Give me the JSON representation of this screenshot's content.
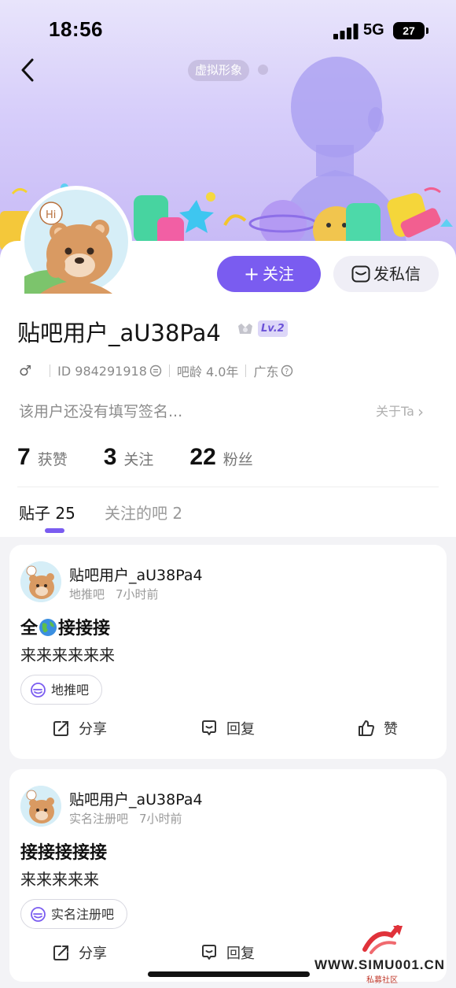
{
  "status_bar": {
    "time": "18:56",
    "network": "5G",
    "battery": "27"
  },
  "header": {
    "virtual_avatar_label": "虚拟形象"
  },
  "profile": {
    "follow_label": "关注",
    "message_label": "发私信",
    "username": "贴吧用户_aU38Pa4",
    "level": "Lv.2",
    "gender_symbol": "♂",
    "id_text": "ID 984291918",
    "bar_age": "吧龄 4.0年",
    "location": "广东",
    "signature": "该用户还没有填写签名...",
    "about_label": "关于Ta",
    "stats": [
      {
        "num": "7",
        "label": "获赞"
      },
      {
        "num": "3",
        "label": "关注"
      },
      {
        "num": "22",
        "label": "粉丝"
      }
    ]
  },
  "tabs": [
    {
      "label": "贴子 25"
    },
    {
      "label": "关注的吧 2"
    }
  ],
  "posts": [
    {
      "author": "贴吧用户_aU38Pa4",
      "forum": "地推吧",
      "time": "7小时前",
      "title_before": "全",
      "title_after": "接接接",
      "body": "来来来来来来",
      "forum_tag": "地推吧"
    },
    {
      "author": "贴吧用户_aU38Pa4",
      "forum": "实名注册吧",
      "time": "7小时前",
      "title": "接接接接接",
      "body": "来来来来来",
      "forum_tag": "实名注册吧"
    }
  ],
  "actions": {
    "share": "分享",
    "reply": "回复",
    "like": "赞"
  },
  "watermark": {
    "text": "WWW.SIMU001.CN",
    "sub": "私募社区"
  },
  "colors": {
    "accent": "#7a5cf0",
    "banner_top": "#e8e4fb",
    "banner_bottom": "#c6b8f5"
  }
}
